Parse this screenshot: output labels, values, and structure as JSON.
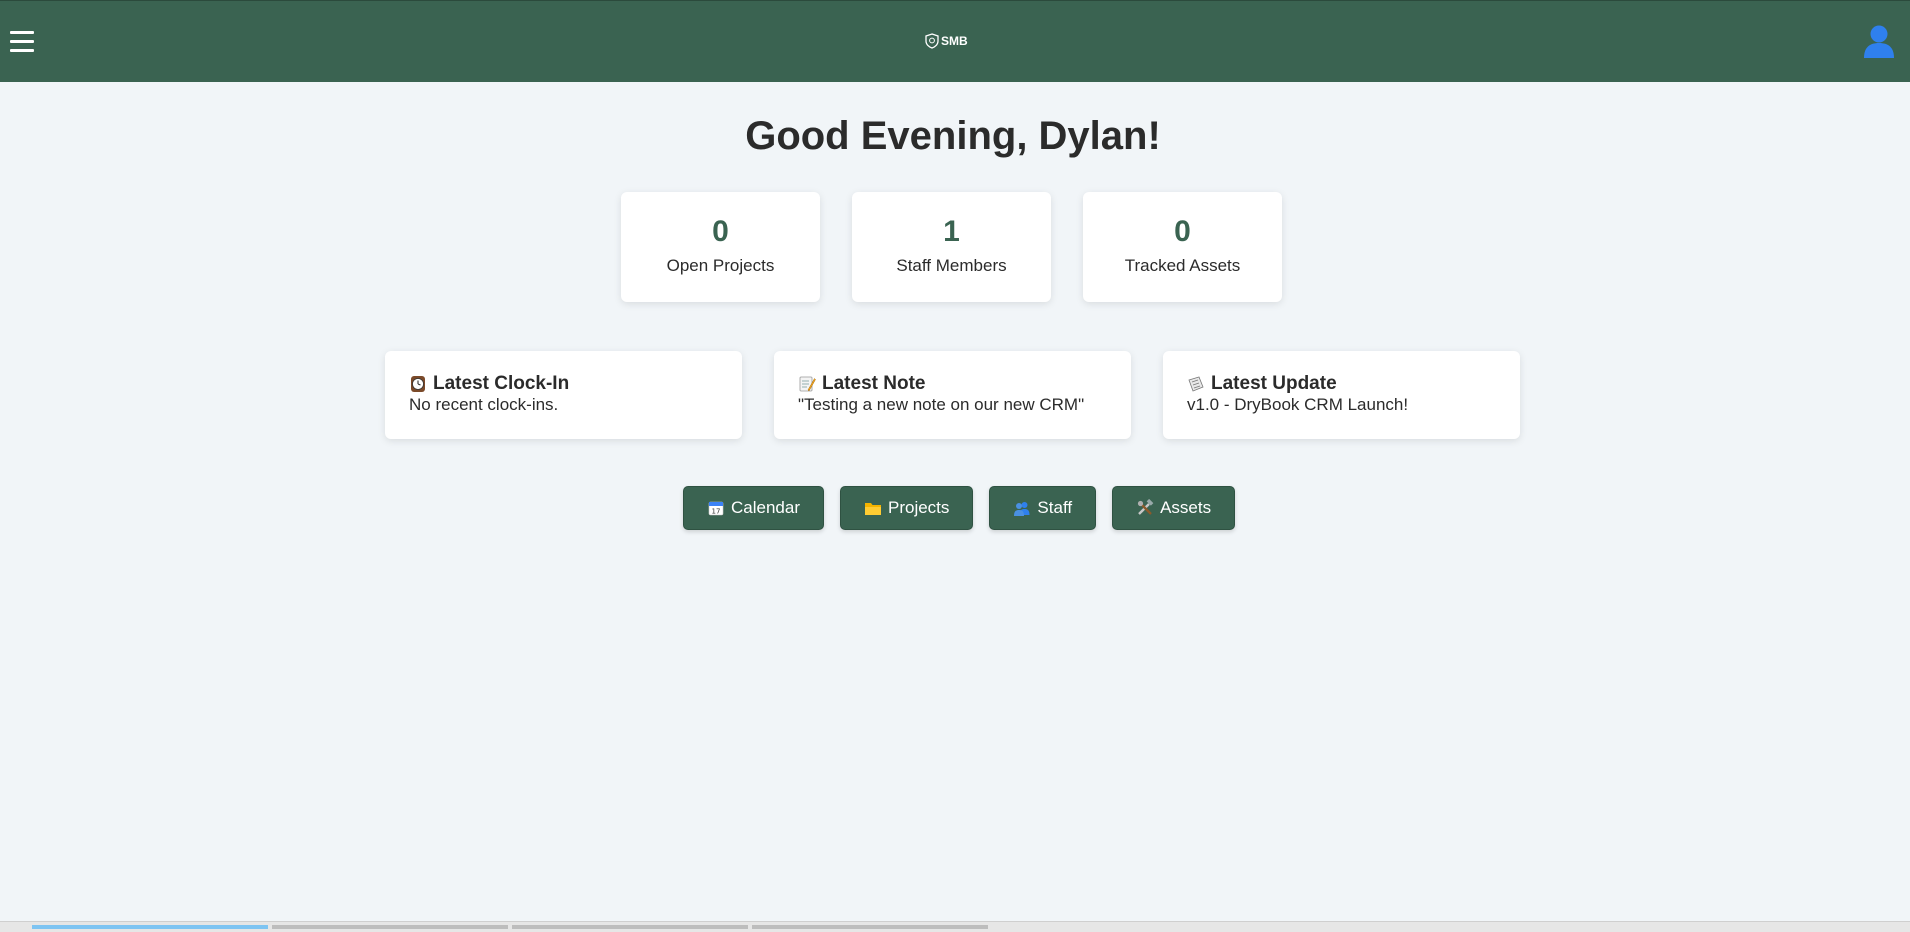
{
  "header": {
    "logo_text": "SMB",
    "menu_icon": "hamburger-menu-icon",
    "profile_icon": "user-avatar-icon",
    "colors": {
      "bar": "#3a6351",
      "icon": "#ffffff",
      "avatar": "#2f80ed"
    }
  },
  "greeting": "Good Evening, Dylan!",
  "stats": [
    {
      "value": "0",
      "label": "Open Projects"
    },
    {
      "value": "1",
      "label": "Staff Members"
    },
    {
      "value": "0",
      "label": "Tracked Assets"
    }
  ],
  "cards": [
    {
      "icon": "clock-icon",
      "title": "Latest Clock-In",
      "text": "No recent clock-ins."
    },
    {
      "icon": "memo-icon",
      "title": "Latest Note",
      "text": "\"Testing a new note on our new CRM\""
    },
    {
      "icon": "newspaper-icon",
      "title": "Latest Update",
      "text": "v1.0 - DryBook CRM Launch!"
    }
  ],
  "buttons": [
    {
      "icon": "calendar-icon",
      "label": "Calendar"
    },
    {
      "icon": "folder-icon",
      "label": "Projects"
    },
    {
      "icon": "people-icon",
      "label": "Staff"
    },
    {
      "icon": "tools-icon",
      "label": "Assets"
    }
  ],
  "accent_color": "#3a6351"
}
